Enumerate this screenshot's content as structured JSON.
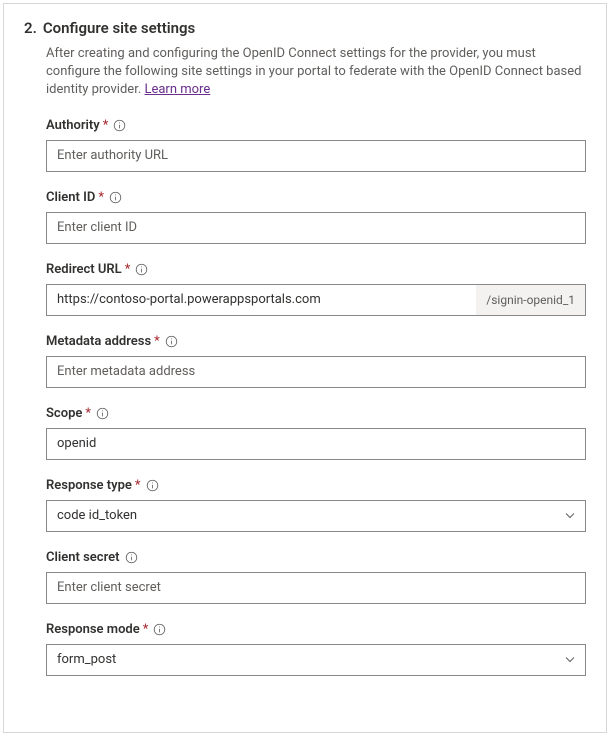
{
  "step_number": "2.",
  "title": "Configure site settings",
  "description": "After creating and configuring the OpenID Connect settings for the provider, you must configure the following site settings in your portal to federate with the OpenID Connect based identity provider. ",
  "learn_more": "Learn more",
  "fields": {
    "authority": {
      "label": "Authority",
      "required": "*",
      "placeholder": "Enter authority URL",
      "value": ""
    },
    "client_id": {
      "label": "Client ID",
      "required": "*",
      "placeholder": "Enter client ID",
      "value": ""
    },
    "redirect_url": {
      "label": "Redirect URL",
      "required": "*",
      "value": "https://contoso-portal.powerappsportals.com",
      "suffix": "/signin-openid_1"
    },
    "metadata_address": {
      "label": "Metadata address",
      "required": "*",
      "placeholder": "Enter metadata address",
      "value": ""
    },
    "scope": {
      "label": "Scope",
      "required": "*",
      "value": "openid"
    },
    "response_type": {
      "label": "Response type",
      "required": "*",
      "value": "code id_token"
    },
    "client_secret": {
      "label": "Client secret",
      "placeholder": "Enter client secret",
      "value": ""
    },
    "response_mode": {
      "label": "Response mode",
      "required": "*",
      "value": "form_post"
    }
  }
}
